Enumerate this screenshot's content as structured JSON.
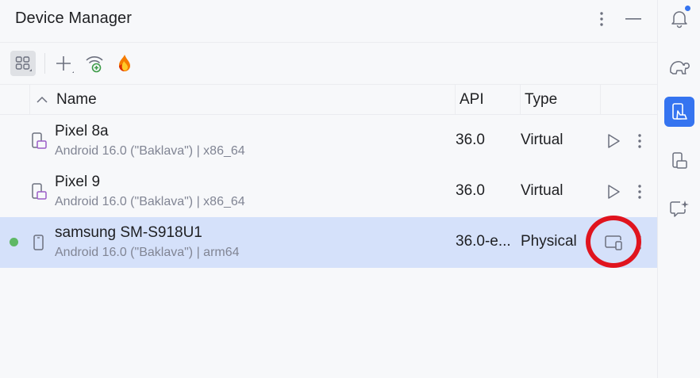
{
  "panel": {
    "title": "Device Manager"
  },
  "toolbar": {
    "icons": [
      "grid-view-icon",
      "add-icon",
      "wifi-pair-icon",
      "firebase-icon"
    ]
  },
  "table": {
    "columns": {
      "name": "Name",
      "api": "API",
      "type": "Type"
    },
    "rows": [
      {
        "name": "Pixel 8a",
        "sub": "Android 16.0 (\"Baklava\") | x86_64",
        "api": "36.0",
        "type": "Virtual",
        "online": false,
        "selected": false
      },
      {
        "name": "Pixel 9",
        "sub": "Android 16.0 (\"Baklava\") | x86_64",
        "api": "36.0",
        "type": "Virtual",
        "online": false,
        "selected": false
      },
      {
        "name": "samsung SM-S918U1",
        "sub": "Android 16.0 (\"Baklava\") | arm64",
        "api": "36.0-e...",
        "type": "Physical",
        "online": true,
        "selected": true
      }
    ]
  },
  "right_toolbar": {
    "icons": [
      "notifications-icon",
      "gradle-elephant-icon",
      "device-manager-icon",
      "running-devices-icon",
      "gemini-chat-icon"
    ],
    "active": "device-manager-icon"
  },
  "colors": {
    "accent": "#3574f0",
    "selected_row": "#d5e1fa",
    "online": "#5fb865",
    "highlight_ring": "#e0141e",
    "firebase_orange": "#f57c00"
  }
}
